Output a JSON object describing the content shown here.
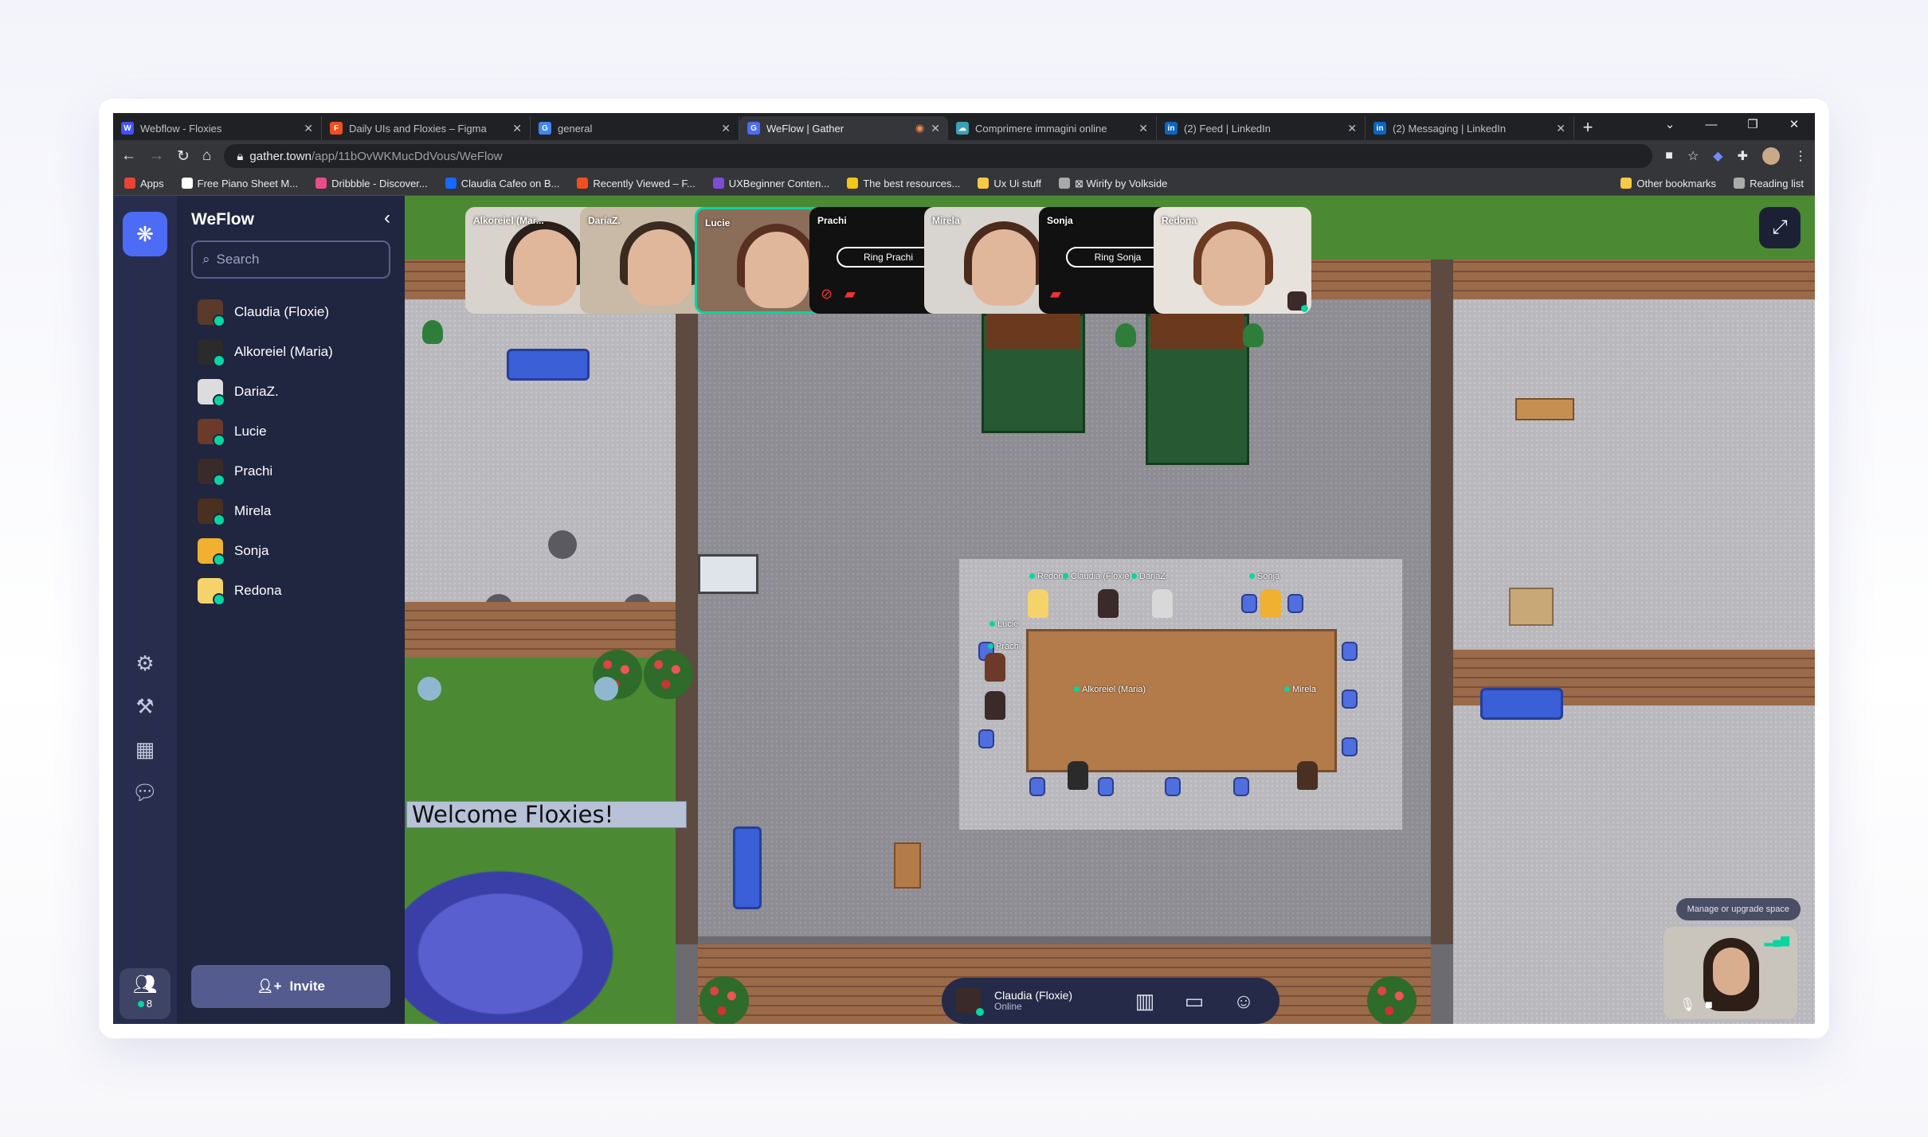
{
  "browser": {
    "tabs": [
      {
        "title": "Webflow - Floxies",
        "favicon_color": "#4353ff",
        "favicon_letter": "W"
      },
      {
        "title": "Daily UIs and Floxies – Figma",
        "favicon_color": "#f24e1e",
        "favicon_letter": "F"
      },
      {
        "title": "general",
        "favicon_color": "#4285f4",
        "favicon_letter": "G"
      },
      {
        "title": "WeFlow | Gather",
        "favicon_color": "#4d6bf5",
        "favicon_letter": "G",
        "active": true
      },
      {
        "title": "Comprimere immagini online",
        "favicon_color": "#3aa0b5",
        "favicon_letter": "☁"
      },
      {
        "title": "(2) Feed | LinkedIn",
        "favicon_color": "#0a66c2",
        "favicon_letter": "in"
      },
      {
        "title": "(2) Messaging | LinkedIn",
        "favicon_color": "#0a66c2",
        "favicon_letter": "in"
      }
    ],
    "url_host": "gather.town",
    "url_path": "/app/11bOvWKMucDdVous/WeFlow",
    "bookmarks": [
      {
        "label": "Apps",
        "color": "#ea4335"
      },
      {
        "label": "Free Piano Sheet M...",
        "color": "#ffffff"
      },
      {
        "label": "Dribbble - Discover...",
        "color": "#ea4c89"
      },
      {
        "label": "Claudia Cafeo on B...",
        "color": "#1769ff"
      },
      {
        "label": "Recently Viewed – F...",
        "color": "#f24e1e"
      },
      {
        "label": "UXBeginner Conten...",
        "color": "#7d4cdb"
      },
      {
        "label": "The best resources...",
        "color": "#f5c518"
      },
      {
        "label": "Ux Ui stuff",
        "color": "#f7c948"
      },
      {
        "label": "⊠ Wirify by Volkside",
        "color": "#aaaaaa"
      }
    ],
    "bookmarks_right": [
      {
        "label": "Other bookmarks",
        "color": "#f7c948"
      },
      {
        "label": "Reading list",
        "color": "#aaaaaa"
      }
    ]
  },
  "sidebar": {
    "space_name": "WeFlow",
    "search_placeholder": "Search",
    "members": [
      {
        "name": "Claudia (Floxie)",
        "color": "#5a3a2a"
      },
      {
        "name": "Alkoreiel (Maria)",
        "color": "#2b2b2b"
      },
      {
        "name": "DariaZ.",
        "color": "#dcdcdc"
      },
      {
        "name": "Lucie",
        "color": "#6b3a2a"
      },
      {
        "name": "Prachi",
        "color": "#3a2a2a"
      },
      {
        "name": "Mirela",
        "color": "#4a3020"
      },
      {
        "name": "Sonja",
        "color": "#f0b030"
      },
      {
        "name": "Redona",
        "color": "#f4d36b"
      }
    ],
    "invite_label": "Invite",
    "online_count": "8"
  },
  "videos": [
    {
      "name": "Alkoreiel (Mar...",
      "camera": true,
      "bg": "#d8d3cc",
      "hair": "#2a1f1a"
    },
    {
      "name": "DariaZ.",
      "camera": true,
      "bg": "#c9b9a7",
      "hair": "#3a2a20"
    },
    {
      "name": "Lucie",
      "camera": true,
      "bg": "#8a6e5a",
      "hair": "#5a3020",
      "speaking": true
    },
    {
      "name": "Prachi",
      "camera": false,
      "ring": "Ring Prachi"
    },
    {
      "name": "Mirela",
      "camera": true,
      "bg": "#d8d4d0",
      "hair": "#4a2a1a"
    },
    {
      "name": "Sonja",
      "camera": false,
      "ring": "Ring Sonja"
    },
    {
      "name": "Redona",
      "camera": true,
      "bg": "#e8e2dc",
      "hair": "#6a3a22"
    }
  ],
  "map": {
    "welcome_sign": "Welcome Floxies!",
    "labels": [
      {
        "name": "Redona"
      },
      {
        "name": "Claudia (Floxie)"
      },
      {
        "name": "DariaZ."
      },
      {
        "name": "Sonja"
      },
      {
        "name": "Lucie"
      },
      {
        "name": "Prachi"
      },
      {
        "name": "Alkoreiel (Maria)"
      },
      {
        "name": "Mirela"
      }
    ],
    "manage_label": "Manage or upgrade space"
  },
  "bottom_bar": {
    "user_name": "Claudia (Floxie)",
    "status": "Online"
  }
}
